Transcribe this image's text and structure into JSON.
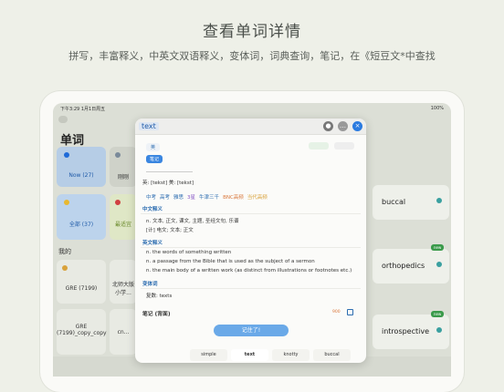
{
  "promo": {
    "title": "查看单词详情",
    "subtitle": "拼写，丰富释义，中英文双语释义，变体词，词典查询，笔记，在《短豆文*中查找"
  },
  "status": {
    "time": "下午3:29  1月1日周五",
    "battery": "100%"
  },
  "library": {
    "title": "单词",
    "tiles": [
      {
        "label": "Now (27)"
      },
      {
        "label": "刚刚"
      },
      {
        "label": "全部 (37)"
      },
      {
        "label": "最适宜"
      }
    ],
    "section": "我的",
    "decks": [
      {
        "label": "GRE (7199)"
      },
      {
        "label": "北师大版 小学..."
      },
      {
        "label": "GRE (7199)_copy_copy"
      },
      {
        "label": "cn..."
      }
    ]
  },
  "right_words": [
    "buccal",
    "orthopedics",
    "introspective"
  ],
  "right_badges": [
    "new",
    "new"
  ],
  "modal": {
    "word": "text",
    "dict_btn": "英",
    "note_tag": "笔记",
    "phonetic": "英: [tekst] 美: [tekst]",
    "tags": [
      "中考",
      "高考",
      "雅思",
      "3星",
      "牛津三千",
      "BNC高频",
      "当代高频"
    ],
    "tag_colors": [
      "#2b6cb0",
      "#2b6cb0",
      "#2b6cb0",
      "#8a5cc7",
      "#2b6cb0",
      "#d9773b",
      "#d9a23b"
    ],
    "cn_label": "中文释义",
    "cn_lines": [
      "n. 文本, 正文, 课文, 主题, 圣经文句, 乐谱",
      "[计] 电文; 文本; 正文"
    ],
    "en_label": "英文释义",
    "en_lines": [
      "n. the words of something written",
      "n. a passage from the Bible that is used as the subject of a sermon",
      "n. the main body of a written work (as distinct from illustrations or footnotes etc.)"
    ],
    "variant_label": "变体词",
    "variant_line": "复数: texts",
    "notes_label": "笔记 (背面)",
    "notes_count": "900",
    "remember_btn": "记住了!"
  },
  "bottom_words": [
    "simple",
    "text",
    "knotty",
    "buccal"
  ]
}
